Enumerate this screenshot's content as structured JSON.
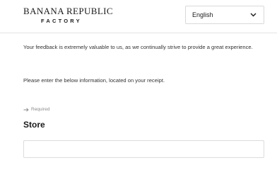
{
  "brand": {
    "name": "BANANA REPUBLIC",
    "subtitle": "FACTORY"
  },
  "language_select": {
    "selected": "English",
    "icon": "chevron-down-icon"
  },
  "content": {
    "intro": "Your feedback is extremely valuable to us, as we continually strive to provide a great experience.",
    "instruction": "Please enter the below information, located on your receipt.",
    "required_note": "Required",
    "required_icon": "arrow-right-icon",
    "store_heading": "Store"
  },
  "store_field": {
    "value": "",
    "placeholder": ""
  },
  "colors": {
    "text": "#1a1a1a",
    "muted": "#8a8a8a",
    "border": "#dcdcdc"
  }
}
